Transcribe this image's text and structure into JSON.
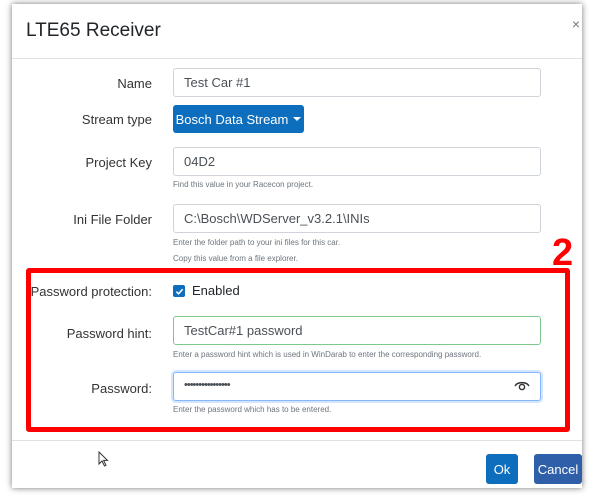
{
  "dialog": {
    "title": "LTE65 Receiver",
    "close_glyph": "×"
  },
  "form": {
    "name_label": "Name",
    "name_value": "Test Car #1",
    "stream_label": "Stream type",
    "stream_value": "Bosch Data Stream",
    "project_key_label": "Project Key",
    "project_key_value": "04D2",
    "project_key_help": "Find this value in your Racecon project.",
    "ini_label": "Ini File Folder",
    "ini_value": "C:\\Bosch\\WDServer_v3.2.1\\INIs",
    "ini_help_1": "Enter the folder path to your ini files for this car.",
    "ini_help_2": "Copy this value from a file explorer.",
    "password_protection_label": "Password protection:",
    "enabled_label": "Enabled",
    "enabled_checked": true,
    "hint_label": "Password hint:",
    "hint_value": "TestCar#1 password",
    "hint_help": "Enter a password hint which is used in WinDarab to enter the corresponding password.",
    "password_label": "Password:",
    "password_value": "••••••••••••••••",
    "password_help": "Enter the password which has to be entered."
  },
  "annotation": {
    "number": "2",
    "color": "#ff0000"
  },
  "buttons": {
    "ok": "Ok",
    "cancel": "Cancel"
  },
  "colors": {
    "primary": "#0d6ebd",
    "secondary": "#2f5fa8",
    "valid_border": "#7ec88c"
  }
}
